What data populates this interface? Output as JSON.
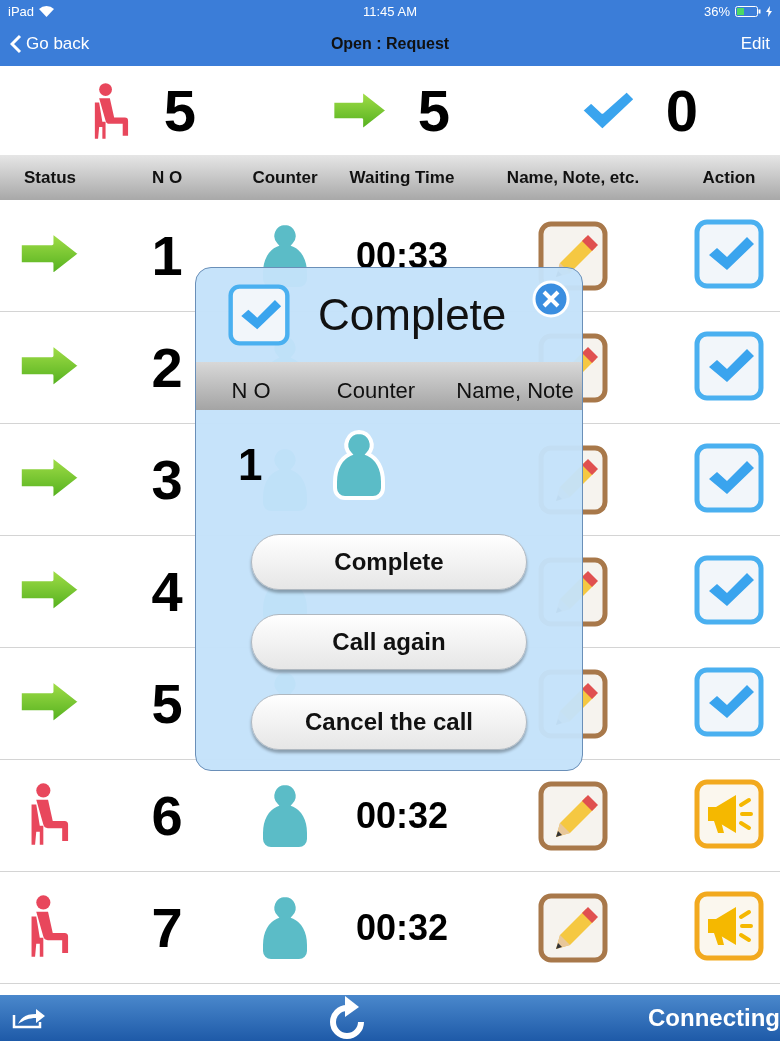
{
  "status_bar": {
    "device": "iPad",
    "time": "11:45 AM",
    "battery": "36%"
  },
  "nav": {
    "back": "Go back",
    "title": "Open : Request",
    "edit": "Edit"
  },
  "summary": [
    {
      "kind": "waiting",
      "count": "5"
    },
    {
      "kind": "called",
      "count": "5"
    },
    {
      "kind": "done",
      "count": "0"
    }
  ],
  "table": {
    "columns": [
      "Status",
      "N O",
      "Counter",
      "Waiting Time",
      "Name, Note, etc.",
      "Action"
    ],
    "rows": [
      {
        "called": true,
        "no": "1",
        "waiting_time": "00:33"
      },
      {
        "called": true,
        "no": "2"
      },
      {
        "called": true,
        "no": "3"
      },
      {
        "called": true,
        "no": "4"
      },
      {
        "called": true,
        "no": "5"
      },
      {
        "called": false,
        "no": "6",
        "waiting_time": "00:32"
      },
      {
        "called": false,
        "no": "7",
        "waiting_time": "00:32"
      }
    ]
  },
  "dialog": {
    "title": "Complete",
    "columns": [
      "N O",
      "Counter",
      "Name, Note"
    ],
    "no": "1",
    "buttons": [
      "Complete",
      "Call again",
      "Cancel the call"
    ]
  },
  "toolbar": {
    "status": "Connecting"
  }
}
